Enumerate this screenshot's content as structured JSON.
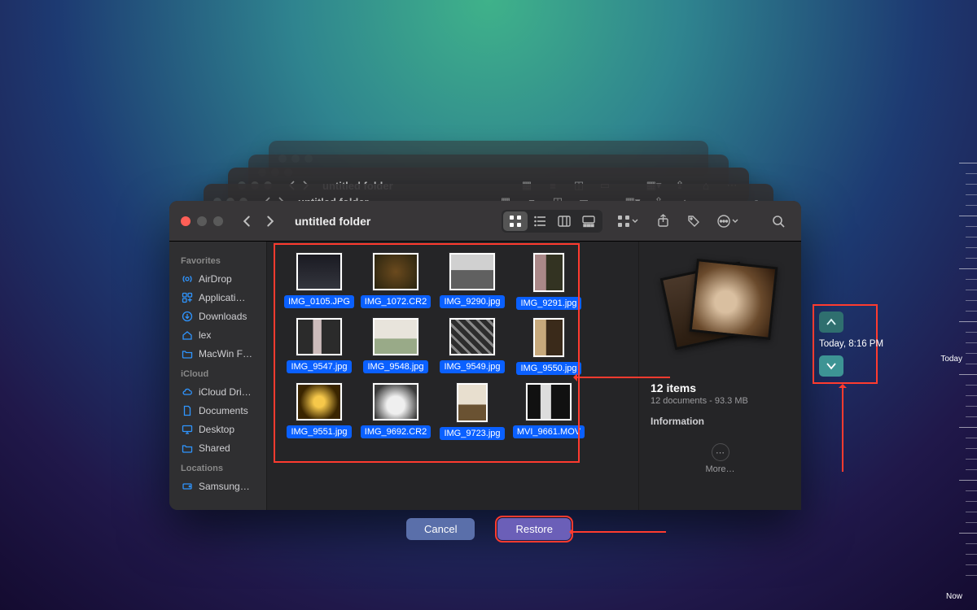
{
  "ghost_title": "untitled folder",
  "window": {
    "title": "untitled folder"
  },
  "sidebar": {
    "sections": [
      {
        "header": "Favorites",
        "items": [
          {
            "icon": "airdrop",
            "label": "AirDrop"
          },
          {
            "icon": "app",
            "label": "Applicati…"
          },
          {
            "icon": "down",
            "label": "Downloads"
          },
          {
            "icon": "home",
            "label": "lex"
          },
          {
            "icon": "folder",
            "label": "MacWin F…"
          }
        ]
      },
      {
        "header": "iCloud",
        "items": [
          {
            "icon": "cloud",
            "label": "iCloud Dri…"
          },
          {
            "icon": "doc",
            "label": "Documents"
          },
          {
            "icon": "desktop",
            "label": "Desktop"
          },
          {
            "icon": "shared",
            "label": "Shared"
          }
        ]
      },
      {
        "header": "Locations",
        "items": [
          {
            "icon": "disk",
            "label": "Samsung…"
          }
        ]
      }
    ]
  },
  "files": [
    {
      "name": "IMG_0105.JPG",
      "bg": "linear-gradient(#1a1a22,#33353d)"
    },
    {
      "name": "IMG_1072.CR2",
      "bg": "radial-gradient(circle at 50% 50%, #6b4a1e, #2a240f)"
    },
    {
      "name": "IMG_9290.jpg",
      "bg": "linear-gradient(#d0d0d0 45%, #606060 46%)"
    },
    {
      "name": "IMG_9291.jpg",
      "bg": "linear-gradient(90deg,#a88 40%,#332 41%)"
    },
    {
      "name": "IMG_9547.jpg",
      "bg": "linear-gradient(90deg,#2b2b2b 35%,#cbb 36% 55%,#2b2b2b 56%)"
    },
    {
      "name": "IMG_9548.jpg",
      "bg": "linear-gradient(#e8e4dc 55%,#9a8 56%)"
    },
    {
      "name": "IMG_9549.jpg",
      "bg": "repeating-linear-gradient(45deg,#2d2d2d 0 6px,#888 6px 9px)"
    },
    {
      "name": "IMG_9550.jpg",
      "bg": "linear-gradient(90deg,#c7a97c 40%,#3a2a1a 41%)"
    },
    {
      "name": "IMG_9551.jpg",
      "bg": "radial-gradient(circle,#f6c84a 20%,#3a2500 70%)"
    },
    {
      "name": "IMG_9692.CR2",
      "bg": "radial-gradient(circle at 50% 60%,#efefef 30%,#3a3a3a 80%)"
    },
    {
      "name": "IMG_9723.jpg",
      "bg": "linear-gradient(#e8dfcf 55%, #6a5232 56%)"
    },
    {
      "name": "MVI_9661.MOV",
      "bg": "linear-gradient(90deg,#111 30%,#ddd 31% 55%,#111 56%)"
    }
  ],
  "preview": {
    "count_label": "12 items",
    "subtitle": "12 documents - 93.3 MB",
    "info_label": "Information",
    "more_label": "More…"
  },
  "buttons": {
    "cancel": "Cancel",
    "restore": "Restore"
  },
  "timemachine": {
    "timestamp": "Today, 8:16 PM"
  },
  "timeline": {
    "top_label": "Today",
    "bottom_label": "Now"
  }
}
